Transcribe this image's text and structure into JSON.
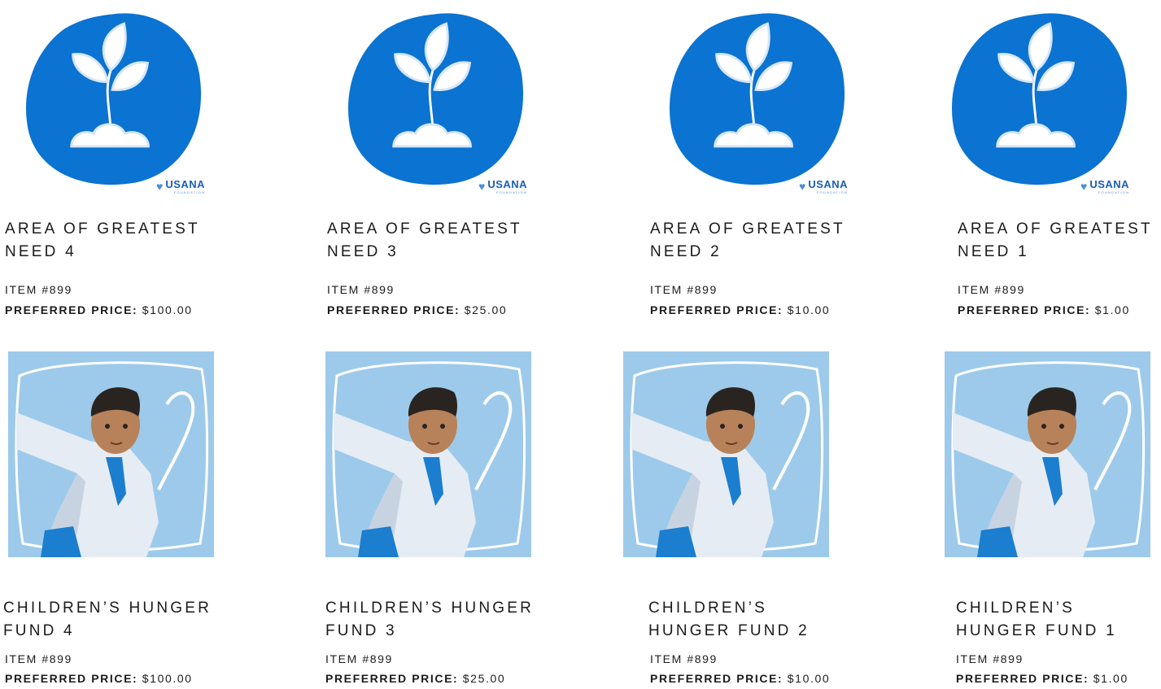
{
  "colors": {
    "blob_blue": "#0b73d1",
    "photo_bg": "#9dcaea",
    "text": "#1b1b1b",
    "logo_blue": "#1a5fb4"
  },
  "icons": {
    "top_row": "sprout-icon",
    "bottom_row": "child-photo",
    "logo": "usana-foundation-logo"
  },
  "logo": {
    "name": "USANA",
    "sub": "FOUNDATION"
  },
  "products_row1": [
    {
      "title_line1": "AREA OF GREATEST",
      "title_line2": "NEED 4",
      "item": "ITEM #899",
      "price_label": "PREFERRED PRICE:",
      "price": "$100.00"
    },
    {
      "title_line1": "AREA OF GREATEST",
      "title_line2": "NEED 3",
      "item": "ITEM #899",
      "price_label": "PREFERRED PRICE:",
      "price": "$25.00"
    },
    {
      "title_line1": "AREA OF GREATEST",
      "title_line2": "NEED 2",
      "item": "ITEM #899",
      "price_label": "PREFERRED PRICE:",
      "price": "$10.00"
    },
    {
      "title_line1": "AREA OF GREATEST",
      "title_line2": "NEED 1",
      "item": "ITEM #899",
      "price_label": "PREFERRED PRICE:",
      "price": "$1.00"
    }
  ],
  "products_row2": [
    {
      "title_line1": "CHILDREN’S HUNGER",
      "title_line2": "FUND 4",
      "item": "ITEM #899",
      "price_label": "PREFERRED PRICE:",
      "price": "$100.00"
    },
    {
      "title_line1": "CHILDREN’S HUNGER",
      "title_line2": "FUND 3",
      "item": "ITEM #899",
      "price_label": "PREFERRED PRICE:",
      "price": "$25.00"
    },
    {
      "title_line1": "CHILDREN’S",
      "title_line2": "HUNGER FUND 2",
      "item": "ITEM #899",
      "price_label": "PREFERRED PRICE:",
      "price": "$10.00"
    },
    {
      "title_line1": "CHILDREN’S",
      "title_line2": "HUNGER FUND 1",
      "item": "ITEM #899",
      "price_label": "PREFERRED PRICE:",
      "price": "$1.00"
    }
  ]
}
